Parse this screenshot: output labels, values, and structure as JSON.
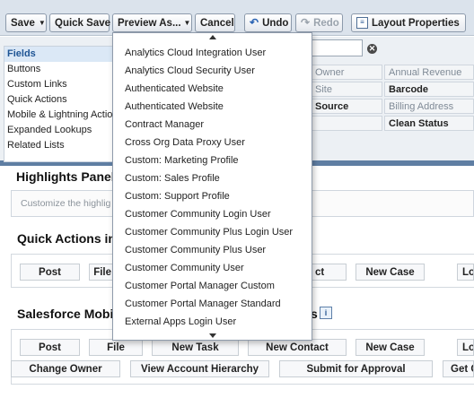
{
  "toolbar": {
    "save": "Save",
    "quick_save": "Quick Save",
    "preview_as": "Preview As...",
    "cancel": "Cancel",
    "undo": "Undo",
    "redo": "Redo",
    "layout_properties": "Layout Properties"
  },
  "palette": {
    "categories": [
      "Fields",
      "Buttons",
      "Custom Links",
      "Quick Actions",
      "Mobile & Lightning Actions",
      "Expanded Lookups",
      "Related Lists"
    ],
    "selected_category": "Fields",
    "fields": [
      "Owner",
      "Annual Revenue",
      "Site",
      "Barcode",
      "Source",
      "Billing Address",
      "Clean Status"
    ]
  },
  "preview_menu": {
    "items": [
      "Analytics Cloud Integration User",
      "Analytics Cloud Security User",
      "Authenticated Website",
      "Authenticated Website",
      "Contract Manager",
      "Cross Org Data Proxy User",
      "Custom: Marketing Profile",
      "Custom: Sales Profile",
      "Custom: Support Profile",
      "Customer Community Login User",
      "Customer Community Plus Login User",
      "Customer Community Plus User",
      "Customer Community User",
      "Customer Portal Manager Custom",
      "Customer Portal Manager Standard",
      "External Apps Login User"
    ]
  },
  "highlights": {
    "title": "Highlights Panel",
    "hint": "Customize the highlig"
  },
  "quick_actions": {
    "title": "Quick Actions in",
    "buttons": [
      "Post",
      "File",
      "ct",
      "New Case",
      "Lo"
    ]
  },
  "sf_mobile": {
    "title": "Salesforce Mobil",
    "title_tail": "s",
    "row1": [
      "Post",
      "File",
      "New Task",
      "New Contact",
      "New Case",
      "Lo"
    ],
    "row2": [
      "Change Owner",
      "View Account Hierarchy",
      "Submit for Approval",
      "Get C"
    ]
  },
  "colors": {
    "toolbar_bg": "#dbe3ec",
    "palette_bg": "#ecf0f4",
    "selected_category": "#dbe8f6",
    "accent": "#5f7ea3"
  }
}
